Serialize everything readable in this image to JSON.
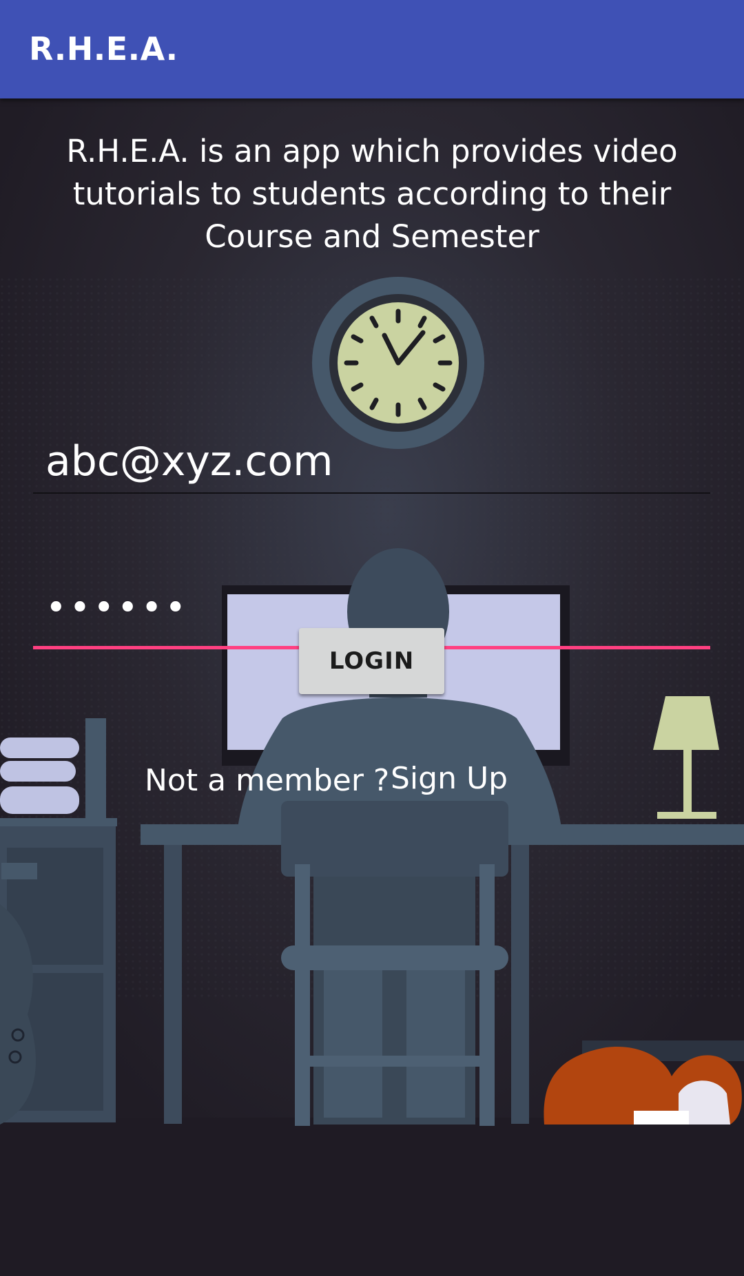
{
  "app_bar": {
    "title": "R.H.E.A."
  },
  "description": "R.H.E.A. is an app which provides video tutorials to students according to their Course and Semester",
  "login_form": {
    "email_value": "abc@xyz.com",
    "password_value": "abcdef",
    "login_label": "LOGIN"
  },
  "signup_prompt": {
    "text": "Not a member ?",
    "link_label": "Sign Up"
  },
  "colors": {
    "app_bar": "#3f51b5",
    "accent": "#ff4081",
    "background": "#211c26",
    "button": "#d6d7d7"
  },
  "background_illustration": {
    "subject": "person-at-desk-night-scene",
    "elements": [
      "wall-clock",
      "monitor",
      "person",
      "chair",
      "desk",
      "desk-lamp",
      "bookshelf",
      "filing-cabinet",
      "guitar",
      "sleeping-dog"
    ]
  }
}
